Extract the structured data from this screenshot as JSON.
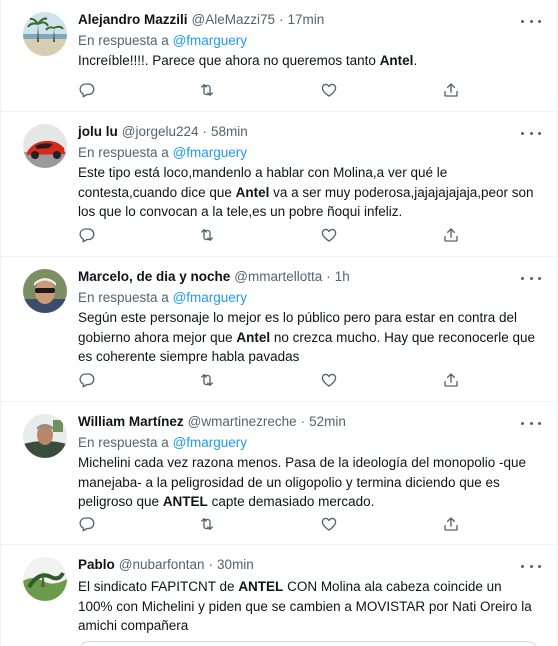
{
  "reply_prefix": "En respuesta a",
  "reply_mention": "@fmarguery",
  "tweets": [
    {
      "name": "Alejandro Mazzili",
      "handle": "@AleMazzi75",
      "time": "17min",
      "text": [
        {
          "t": "Increíble!!!!. Parece que ahora no queremos tanto "
        },
        {
          "t": "Antel",
          "b": true
        },
        {
          "t": "."
        }
      ]
    },
    {
      "name": "jolu lu",
      "handle": "@jorgelu224",
      "time": "58min",
      "text": [
        {
          "t": "Este tipo está loco,mandenlo a hablar con Molina,a ver qué le contesta,cuando dice que "
        },
        {
          "t": "Antel",
          "b": true
        },
        {
          "t": "  va a ser muy poderosa,jajajajajaja,peor son los que lo convocan a la tele,es un pobre ñoqui infeliz."
        }
      ]
    },
    {
      "name": "Marcelo, de dia y noche",
      "handle": "@mmartellotta",
      "time": "1h",
      "text": [
        {
          "t": "Según este personaje lo mejor es lo público pero para estar en contra del gobierno ahora mejor que "
        },
        {
          "t": "Antel",
          "b": true
        },
        {
          "t": " no crezca mucho. Hay que reconocerle que es coherente siempre habla pavadas"
        }
      ]
    },
    {
      "name": "William Martínez",
      "handle": "@wmartinezreche",
      "time": "52min",
      "text": [
        {
          "t": "Michelini cada vez razona menos. Pasa de la ideología del monopolio -que manejaba- a la peligrosidad de un oligopolio y termina diciendo que es peligroso que "
        },
        {
          "t": "ANTEL",
          "b": true
        },
        {
          "t": " capte demasiado mercado."
        }
      ]
    },
    {
      "name": "Pablo",
      "handle": "@nubarfontan",
      "time": "30min",
      "text": [
        {
          "t": "El sindicato FAPITCNT de "
        },
        {
          "t": "ANTEL",
          "b": true
        },
        {
          "t": " CON Molina ala cabeza  coincide un 100% con Michelini y piden que se cambien a MOVISTAR por Nati Oreiro la amichi compañera"
        }
      ]
    }
  ],
  "colors": {
    "mention": "#1d9bf0",
    "secondary_text": "#536471",
    "primary_text": "#0f1419",
    "divider": "#eff3f4"
  },
  "icons": [
    "reply-icon",
    "retweet-icon",
    "like-icon",
    "share-icon",
    "more-options-icon"
  ]
}
